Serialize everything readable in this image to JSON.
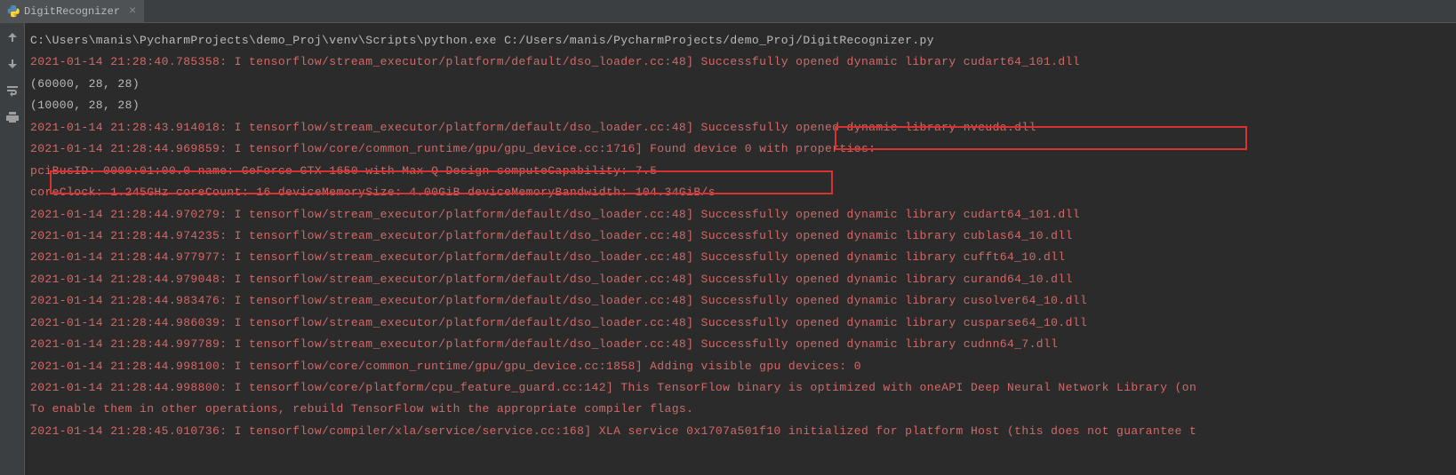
{
  "tab": {
    "name": "DigitRecognizer"
  },
  "console": {
    "lines": [
      {
        "type": "white",
        "text": "C:\\Users\\manis\\PycharmProjects\\demo_Proj\\venv\\Scripts\\python.exe C:/Users/manis/PycharmProjects/demo_Proj/DigitRecognizer.py"
      },
      {
        "type": "red",
        "text": "2021-01-14 21:28:40.785358: I tensorflow/stream_executor/platform/default/dso_loader.cc:48] Successfully opened dynamic library cudart64_101.dll"
      },
      {
        "type": "white",
        "text": "(60000, 28, 28)"
      },
      {
        "type": "white",
        "text": "(10000, 28, 28)"
      },
      {
        "type": "red",
        "text": "2021-01-14 21:28:43.914018: I tensorflow/stream_executor/platform/default/dso_loader.cc:48] Successfully opened dynamic library nvcuda.dll"
      },
      {
        "type": "red",
        "text": "2021-01-14 21:28:44.969859: I tensorflow/core/common_runtime/gpu/gpu_device.cc:1716] Found device 0 with properties:"
      },
      {
        "type": "red",
        "text": "pciBusID: 0000:01:00.0 name: GeForce GTX 1650 with Max-Q Design computeCapability: 7.5"
      },
      {
        "type": "red",
        "text": "coreClock: 1.245GHz coreCount: 16 deviceMemorySize: 4.00GiB deviceMemoryBandwidth: 104.34GiB/s"
      },
      {
        "type": "red",
        "text": "2021-01-14 21:28:44.970279: I tensorflow/stream_executor/platform/default/dso_loader.cc:48] Successfully opened dynamic library cudart64_101.dll"
      },
      {
        "type": "red",
        "text": "2021-01-14 21:28:44.974235: I tensorflow/stream_executor/platform/default/dso_loader.cc:48] Successfully opened dynamic library cublas64_10.dll"
      },
      {
        "type": "red",
        "text": "2021-01-14 21:28:44.977977: I tensorflow/stream_executor/platform/default/dso_loader.cc:48] Successfully opened dynamic library cufft64_10.dll"
      },
      {
        "type": "red",
        "text": "2021-01-14 21:28:44.979048: I tensorflow/stream_executor/platform/default/dso_loader.cc:48] Successfully opened dynamic library curand64_10.dll"
      },
      {
        "type": "red",
        "text": "2021-01-14 21:28:44.983476: I tensorflow/stream_executor/platform/default/dso_loader.cc:48] Successfully opened dynamic library cusolver64_10.dll"
      },
      {
        "type": "red",
        "text": "2021-01-14 21:28:44.986039: I tensorflow/stream_executor/platform/default/dso_loader.cc:48] Successfully opened dynamic library cusparse64_10.dll"
      },
      {
        "type": "red",
        "text": "2021-01-14 21:28:44.997789: I tensorflow/stream_executor/platform/default/dso_loader.cc:48] Successfully opened dynamic library cudnn64_7.dll"
      },
      {
        "type": "red",
        "text": "2021-01-14 21:28:44.998100: I tensorflow/core/common_runtime/gpu/gpu_device.cc:1858] Adding visible gpu devices: 0"
      },
      {
        "type": "red",
        "text": "2021-01-14 21:28:44.998800: I tensorflow/core/platform/cpu_feature_guard.cc:142] This TensorFlow binary is optimized with oneAPI Deep Neural Network Library (on"
      },
      {
        "type": "red",
        "text": "To enable them in other operations, rebuild TensorFlow with the appropriate compiler flags."
      },
      {
        "type": "red",
        "text": "2021-01-14 21:28:45.010736: I tensorflow/compiler/xla/service/service.cc:168] XLA service 0x1707a501f10 initialized for platform Host (this does not guarantee t"
      }
    ]
  }
}
